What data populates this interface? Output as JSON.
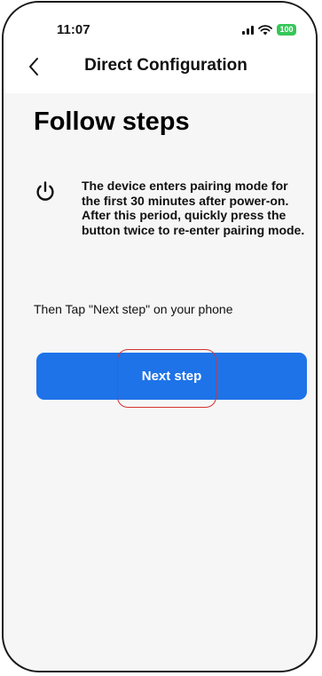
{
  "status_bar": {
    "time": "11:07",
    "battery_level": "100",
    "icons": [
      "signal-icon",
      "wifi-icon",
      "battery-icon"
    ]
  },
  "nav": {
    "title": "Direct Configuration",
    "back_icon": "chevron-left-icon"
  },
  "page": {
    "title": "Follow steps",
    "step_icon": "power-icon",
    "step_text": "The device enters pairing mode for the first 30 minutes after power-on. After this period, quickly press the button twice to re-enter pairing mode.",
    "instruction": "Then Tap \"Next step\" on your phone",
    "next_button_label": "Next step"
  },
  "colors": {
    "accent": "#1e73e8",
    "highlight": "#d4332f",
    "battery": "#35c759",
    "background": "#f6f6f7"
  }
}
